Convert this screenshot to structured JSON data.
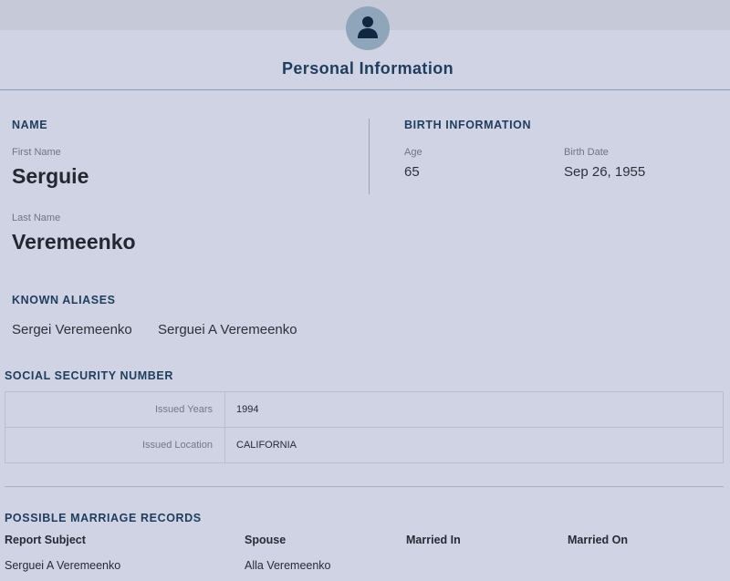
{
  "header": {
    "avatar_icon": "user-icon",
    "title": "Personal Information"
  },
  "name": {
    "heading": "NAME",
    "first_label": "First Name",
    "first_value": "Serguie",
    "last_label": "Last Name",
    "last_value": "Veremeenko"
  },
  "birth": {
    "heading": "BIRTH INFORMATION",
    "age_label": "Age",
    "age_value": "65",
    "date_label": "Birth Date",
    "date_value": "Sep 26, 1955"
  },
  "aliases": {
    "heading": "KNOWN ALIASES",
    "items": [
      "Sergei Veremeenko",
      "Serguei A Veremeenko"
    ]
  },
  "ssn": {
    "heading": "SOCIAL SECURITY NUMBER",
    "rows": [
      {
        "label": "Issued Years",
        "value": "1994"
      },
      {
        "label": "Issued Location",
        "value": "CALIFORNIA"
      }
    ]
  },
  "marriage": {
    "heading": "POSSIBLE MARRIAGE RECORDS",
    "columns": [
      "Report Subject",
      "Spouse",
      "Married In",
      "Married On"
    ],
    "rows": [
      [
        "Serguei A Veremeenko",
        "Alla Veremeenko",
        "",
        ""
      ]
    ]
  },
  "colors": {
    "background": "#cfd3e3",
    "accent": "#1f3d5c",
    "avatar_bg": "#8fa5b9"
  }
}
